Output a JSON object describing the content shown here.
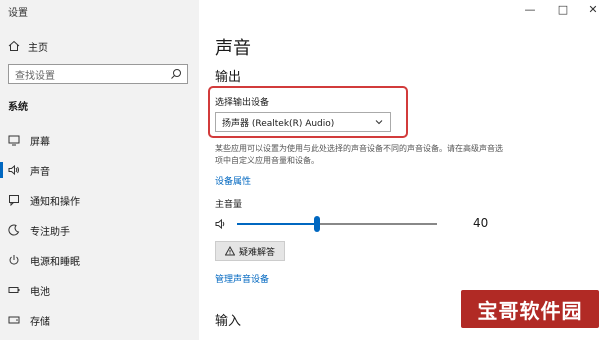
{
  "window": {
    "title": "设置",
    "controls": {
      "minimize": "—",
      "maximize": "□",
      "close": "✕"
    }
  },
  "sidebar": {
    "home_label": "主页",
    "search_placeholder": "查找设置",
    "section_label": "系统",
    "items": [
      {
        "label": "屏幕",
        "icon": "monitor-icon"
      },
      {
        "label": "声音",
        "icon": "speaker-icon",
        "active": true
      },
      {
        "label": "通知和操作",
        "icon": "notification-icon"
      },
      {
        "label": "专注助手",
        "icon": "moon-icon"
      },
      {
        "label": "电源和睡眠",
        "icon": "power-icon"
      },
      {
        "label": "电池",
        "icon": "battery-icon"
      },
      {
        "label": "存储",
        "icon": "storage-icon"
      }
    ]
  },
  "main": {
    "title": "声音",
    "output_heading": "输出",
    "choose_device_label": "选择输出设备",
    "selected_device": "扬声器 (Realtek(R) Audio)",
    "description": "某些应用可以设置为使用与此处选择的声音设备不同的声音设备。请在高级声音选项中自定义应用音量和设备。",
    "device_props_link": "设备属性",
    "master_volume_label": "主音量",
    "volume_value": "40",
    "volume_fraction": 0.4,
    "troubleshoot_label": "疑难解答",
    "manage_devices_link": "管理声音设备",
    "input_heading": "输入"
  },
  "watermark": {
    "text": "宝哥软件园"
  },
  "colors": {
    "accent": "#0067c0",
    "highlight_box": "#d23b3b",
    "watermark_bg": "#b12a25"
  }
}
